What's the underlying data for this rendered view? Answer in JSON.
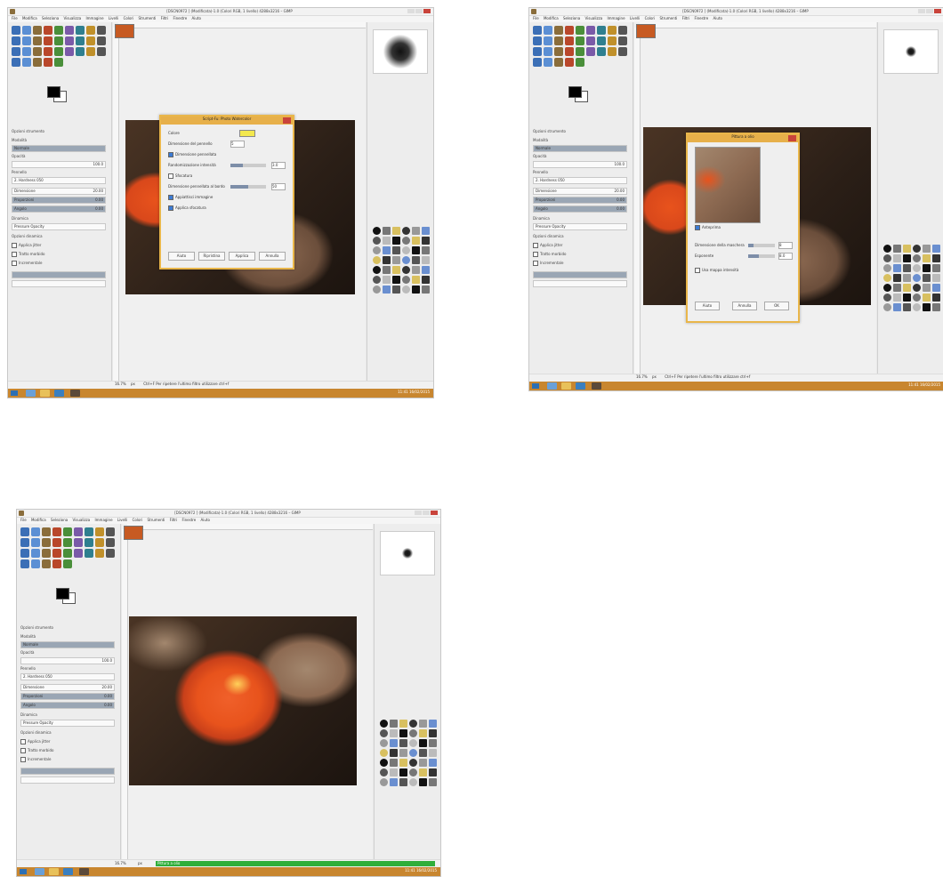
{
  "colors": {
    "photo_flower": "#e8531c",
    "photo_bg_dark": "#2b1f17",
    "photo_bg_brown": "#8d6a52",
    "taskbar": "#c8862f",
    "dialog_accent": "#e7b04a",
    "progress": "#2fae3a"
  },
  "screens": [
    {
      "window_title": "[DSCN0972 ] (Modificata)-1.0 (Colori RGB, 1 livello) 4288x3216 – GIMP",
      "menu": [
        "File",
        "Modifica",
        "Seleziona",
        "Visualizza",
        "Immagine",
        "Livelli",
        "Colori",
        "Strumenti",
        "Filtri",
        "Finestre",
        "Aiuto"
      ],
      "dialog": {
        "title": "Script-Fu: Photo Watercolor",
        "rows": [
          {
            "label": "Colore"
          },
          {
            "label": "Dimensione del pennello",
            "value": "5"
          },
          {
            "label": "Dimensione pennellata",
            "checked": true
          },
          {
            "label": "Randomizzazione intensità",
            "value": "3.0"
          },
          {
            "label": "Sfocatura",
            "checked": false
          },
          {
            "label": "Dimensione pennellata al bordo",
            "value": "50"
          },
          {
            "label": "Appiattisci immagine",
            "checked": true
          },
          {
            "label": "Applica sfocatura",
            "checked": true
          }
        ],
        "buttons": [
          "Aiuto",
          "Ripristina",
          "Applica",
          "Annulla"
        ]
      },
      "status": "Ctrl+F Per ripetere l'ultimo filtro utilizzare ctrl+f"
    },
    {
      "window_title": "[DSCN0972 ] (Modificata)-1.0 (Colori RGB, 1 livello) 4288x3216 – GIMP",
      "menu": [
        "File",
        "Modifica",
        "Seleziona",
        "Visualizza",
        "Immagine",
        "Livelli",
        "Colori",
        "Strumenti",
        "Filtri",
        "Finestre",
        "Aiuto"
      ],
      "dialog": {
        "title": "Pittura a olio",
        "preview_label": "Anteprima",
        "rows": [
          {
            "label": "Dimensione della maschera",
            "value": "8"
          },
          {
            "label": "Esponente",
            "value": "8.0"
          },
          {
            "label": "Usa mappa intensità",
            "checked": false
          }
        ],
        "buttons": [
          "Aiuto",
          "Annulla",
          "OK"
        ]
      },
      "status": "Ctrl+F Per ripetere l'ultimo filtro utilizzare ctrl+f"
    },
    {
      "window_title": "[DSCN0972 ] (Modificata)-1.0 (Colori RGB, 1 livello) 4288x3216 – GIMP",
      "menu": [
        "File",
        "Modifica",
        "Seleziona",
        "Visualizza",
        "Immagine",
        "Livelli",
        "Colori",
        "Strumenti",
        "Filtri",
        "Finestre",
        "Aiuto"
      ],
      "progress_label": "Pittura a olio",
      "progress": 1.0
    }
  ],
  "common": {
    "zoom": "16.7%",
    "unit": "px",
    "toolbox_option_title": "Opzioni strumento",
    "mode_label": "Modalità",
    "mode_value": "Normale",
    "opacity_label": "Opacità",
    "opacity_value": "100.0",
    "brush_label": "Pennello",
    "brush_value": "2. Hardness 050",
    "size_label": "Dimensione",
    "size_value": "20.00",
    "aspect_label": "Proporzioni",
    "aspect_value": "0.00",
    "angle_label": "Angolo",
    "angle_value": "0.00",
    "dynamics_label": "Dinamica",
    "dynamics_value": "Pressure Opacity",
    "dyn_options_label": "Opzioni dinamica",
    "jitter_label": "Applica jitter",
    "smooth_label": "Tratto morbido",
    "incremental_label": "Incrementale",
    "time_left": "11:41",
    "date": "16/02/2015"
  }
}
